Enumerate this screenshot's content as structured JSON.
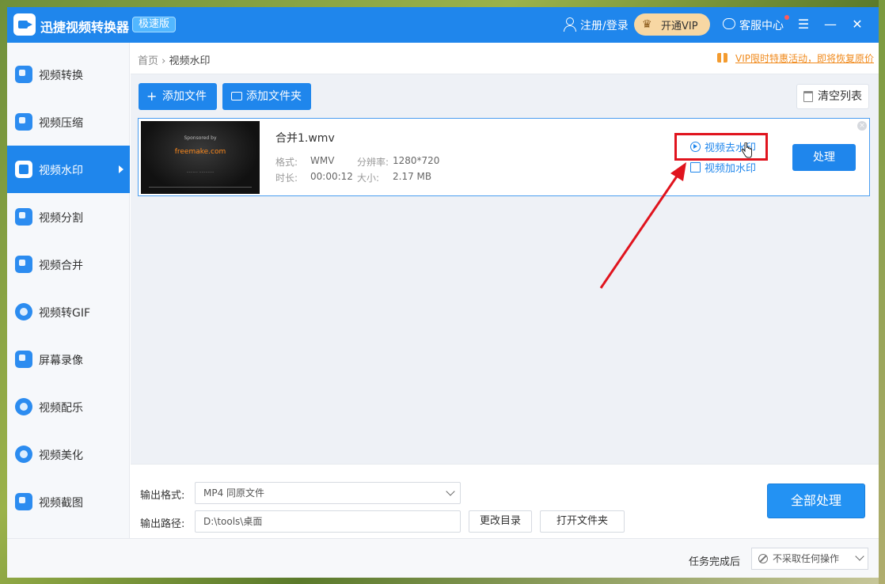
{
  "titlebar": {
    "app_title": "迅捷视频转换器",
    "edition_badge": "极速版",
    "login": "注册/登录",
    "vip": "开通VIP",
    "service": "客服中心",
    "menu_glyph": "☰",
    "minimize_glyph": "—",
    "close_glyph": "✕"
  },
  "sidebar": {
    "items": [
      {
        "label": "视频转换",
        "icon": "video-convert-icon"
      },
      {
        "label": "视频压缩",
        "icon": "video-compress-icon"
      },
      {
        "label": "视频水印",
        "icon": "video-watermark-icon",
        "active": true
      },
      {
        "label": "视频分割",
        "icon": "video-split-icon"
      },
      {
        "label": "视频合并",
        "icon": "video-merge-icon"
      },
      {
        "label": "视频转GIF",
        "icon": "video-gif-icon"
      },
      {
        "label": "屏幕录像",
        "icon": "screen-record-icon"
      },
      {
        "label": "视频配乐",
        "icon": "video-music-icon"
      },
      {
        "label": "视频美化",
        "icon": "video-beautify-icon"
      },
      {
        "label": "视频截图",
        "icon": "video-screenshot-icon"
      }
    ]
  },
  "breadcrumb": {
    "home": "首页",
    "separator": "›",
    "current": "视频水印"
  },
  "promo": {
    "text": "VIP限时特惠活动，即将恢复原价"
  },
  "toolbar": {
    "add_file": "添加文件",
    "add_folder": "添加文件夹",
    "clear_list": "清空列表",
    "plus_glyph": "+"
  },
  "file": {
    "name": "合并1.wmv",
    "format_label": "格式:",
    "format": "WMV",
    "resolution_label": "分辨率:",
    "resolution": "1280*720",
    "duration_label": "时长:",
    "duration": "00:00:12",
    "size_label": "大小:",
    "size": "2.17 MB",
    "remove_watermark": "视频去水印",
    "add_watermark": "视频加水印",
    "process": "处理",
    "thumb_sponsor": "Sponsored by",
    "thumb_brand": "freemake.com",
    "close_glyph": "×"
  },
  "output": {
    "format_label": "输出格式:",
    "format_value": "MP4  同原文件",
    "path_label": "输出路径:",
    "path_value": "D:\\tools\\桌面",
    "change_dir": "更改目录",
    "open_folder": "打开文件夹",
    "process_all": "全部处理"
  },
  "status": {
    "after_label": "任务完成后",
    "after_value": "不采取任何操作"
  },
  "colors": {
    "accent": "#1f86ec",
    "promo": "#f08a1c",
    "highlight": "#e0141e"
  }
}
